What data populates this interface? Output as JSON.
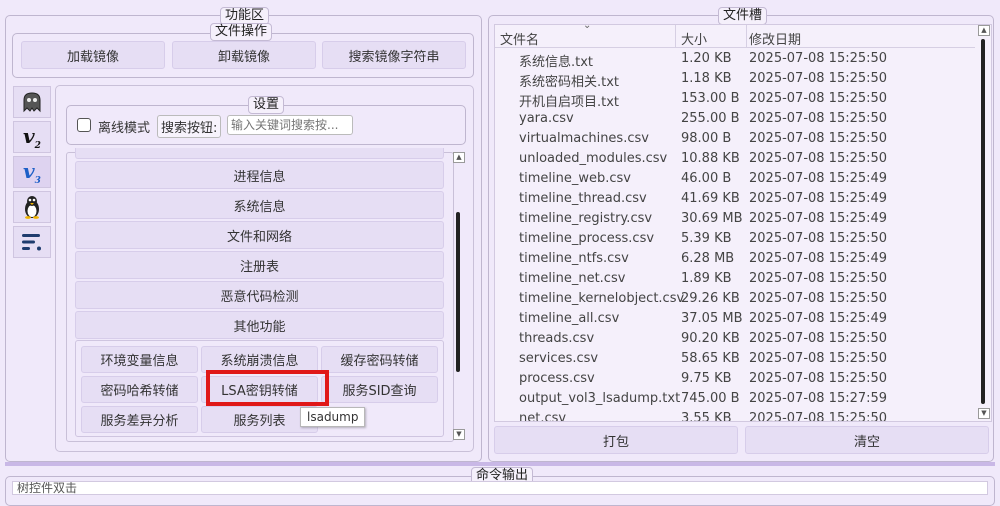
{
  "function_area": {
    "title": "功能区",
    "file_ops": {
      "title": "文件操作",
      "load_label": "加载镜像",
      "unload_label": "卸载镜像",
      "search_label": "搜索镜像字符串"
    },
    "settings": {
      "title": "设置",
      "offline_label": "离线模式",
      "search_button_label": "搜索按钮:",
      "search_placeholder": "输入关键词搜索按..."
    },
    "categories": [
      "进程信息",
      "系统信息",
      "文件和网络",
      "注册表",
      "恶意代码检测",
      "其他功能"
    ],
    "sub_buttons": [
      [
        "环境变量信息",
        "系统崩溃信息",
        "缓存密码转储"
      ],
      [
        "密码哈希转储",
        "LSA密钥转储",
        "服务SID查询"
      ],
      [
        "服务差异分析",
        "服务列表",
        ""
      ]
    ],
    "tooltip": "lsadump",
    "tabs": [
      "ghost-icon",
      "v2-icon",
      "v3-icon",
      "linux-penguin-icon",
      "list-icon"
    ]
  },
  "file_slot": {
    "title": "文件槽",
    "columns": [
      "文件名",
      "大小",
      "修改日期"
    ],
    "rows": [
      [
        "系统信息.txt",
        "1.20 KB",
        "2025-07-08 15:25:50"
      ],
      [
        "系统密码相关.txt",
        "1.18 KB",
        "2025-07-08 15:25:50"
      ],
      [
        "开机自启项目.txt",
        "153.00 B",
        "2025-07-08 15:25:50"
      ],
      [
        "yara.csv",
        "255.00 B",
        "2025-07-08 15:25:50"
      ],
      [
        "virtualmachines.csv",
        "98.00 B",
        "2025-07-08 15:25:50"
      ],
      [
        "unloaded_modules.csv",
        "10.88 KB",
        "2025-07-08 15:25:50"
      ],
      [
        "timeline_web.csv",
        "46.00 B",
        "2025-07-08 15:25:49"
      ],
      [
        "timeline_thread.csv",
        "41.69 KB",
        "2025-07-08 15:25:49"
      ],
      [
        "timeline_registry.csv",
        "30.69 MB",
        "2025-07-08 15:25:49"
      ],
      [
        "timeline_process.csv",
        "5.39 KB",
        "2025-07-08 15:25:50"
      ],
      [
        "timeline_ntfs.csv",
        "6.28 MB",
        "2025-07-08 15:25:49"
      ],
      [
        "timeline_net.csv",
        "1.89 KB",
        "2025-07-08 15:25:50"
      ],
      [
        "timeline_kernelobject.csv",
        "29.26 KB",
        "2025-07-08 15:25:50"
      ],
      [
        "timeline_all.csv",
        "37.05 MB",
        "2025-07-08 15:25:49"
      ],
      [
        "threads.csv",
        "90.20 KB",
        "2025-07-08 15:25:50"
      ],
      [
        "services.csv",
        "58.65 KB",
        "2025-07-08 15:25:50"
      ],
      [
        "process.csv",
        "9.75 KB",
        "2025-07-08 15:25:50"
      ],
      [
        "output_vol3_lsadump.txt",
        "745.00 B",
        "2025-07-08 15:27:59"
      ],
      [
        "net.csv",
        "3.55 KB",
        "2025-07-08 15:25:50"
      ]
    ],
    "pack_label": "打包",
    "clear_label": "清空"
  },
  "command_output": {
    "title": "命令输出",
    "first_line": "树控件双击"
  },
  "colors": {
    "highlight_border": "#e01818",
    "background": "#f0e9fa",
    "button": "#e6def4"
  }
}
